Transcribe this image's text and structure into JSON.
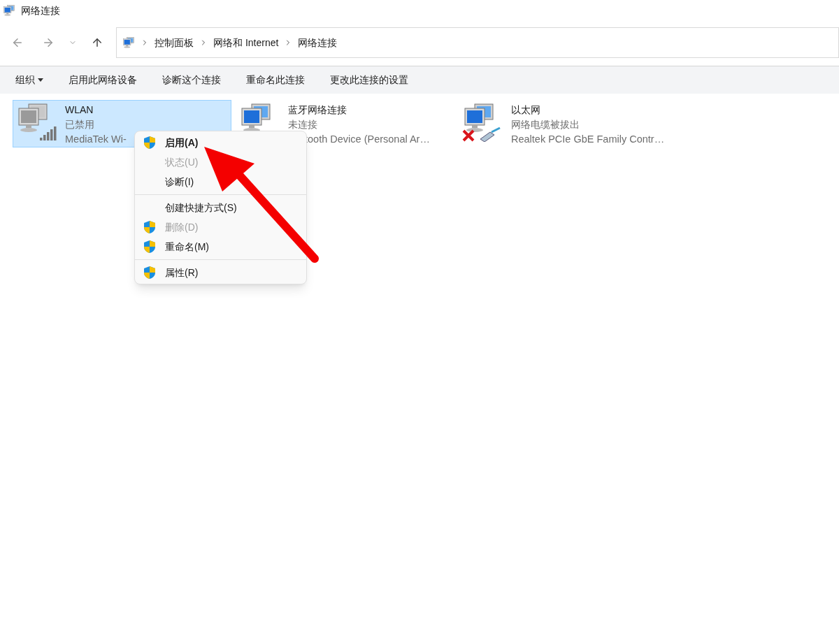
{
  "window": {
    "title": "网络连接"
  },
  "breadcrumb": [
    "控制面板",
    "网络和 Internet",
    "网络连接"
  ],
  "toolbar": [
    {
      "label": "组织",
      "dropdown": true
    },
    {
      "label": "启用此网络设备",
      "dropdown": false
    },
    {
      "label": "诊断这个连接",
      "dropdown": false
    },
    {
      "label": "重命名此连接",
      "dropdown": false
    },
    {
      "label": "更改此连接的设置",
      "dropdown": false
    }
  ],
  "connections": [
    {
      "kind": "wifi",
      "name": "WLAN",
      "status": "已禁用",
      "device": "MediaTek Wi-",
      "selected": true,
      "disabled": true,
      "error": false
    },
    {
      "kind": "bluetooth",
      "name": "蓝牙网络连接",
      "status": "未连接",
      "device": "tooth Device (Personal Ar…",
      "selected": false,
      "disabled": false,
      "error": false
    },
    {
      "kind": "ethernet",
      "name": "以太网",
      "status": "网络电缆被拔出",
      "device": "Realtek PCIe GbE Family Contr…",
      "selected": false,
      "disabled": false,
      "error": true
    }
  ],
  "context_menu": [
    {
      "kind": "item",
      "label": "启用(A)",
      "shield": true,
      "default": true,
      "disabled": false
    },
    {
      "kind": "item",
      "label": "状态(U)",
      "shield": false,
      "default": false,
      "disabled": true
    },
    {
      "kind": "item",
      "label": "诊断(I)",
      "shield": false,
      "default": false,
      "disabled": false
    },
    {
      "kind": "separator"
    },
    {
      "kind": "item",
      "label": "创建快捷方式(S)",
      "shield": false,
      "default": false,
      "disabled": false
    },
    {
      "kind": "item",
      "label": "删除(D)",
      "shield": true,
      "default": false,
      "disabled": true
    },
    {
      "kind": "item",
      "label": "重命名(M)",
      "shield": true,
      "default": false,
      "disabled": false
    },
    {
      "kind": "separator"
    },
    {
      "kind": "item",
      "label": "属性(R)",
      "shield": true,
      "default": false,
      "disabled": false
    }
  ]
}
